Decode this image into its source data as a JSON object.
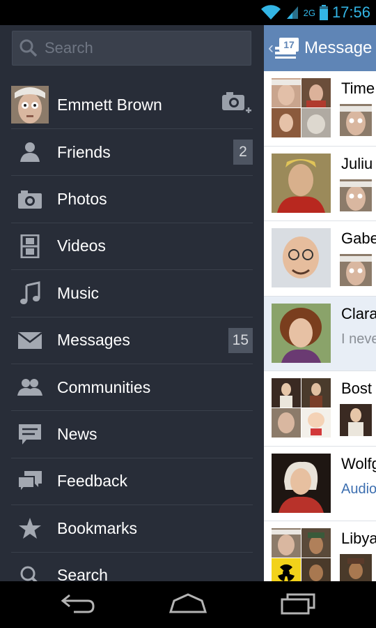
{
  "status_bar": {
    "signal_label": "2G",
    "time": "17:56"
  },
  "drawer": {
    "search_placeholder": "Search",
    "profile": {
      "name": "Emmett Brown"
    },
    "items": [
      {
        "label": "Friends",
        "icon": "person-icon",
        "badge": "2"
      },
      {
        "label": "Photos",
        "icon": "camera-icon"
      },
      {
        "label": "Videos",
        "icon": "film-icon"
      },
      {
        "label": "Music",
        "icon": "music-note-icon"
      },
      {
        "label": "Messages",
        "icon": "envelope-icon",
        "badge": "15"
      },
      {
        "label": "Communities",
        "icon": "group-icon"
      },
      {
        "label": "News",
        "icon": "speech-bubble-icon"
      },
      {
        "label": "Feedback",
        "icon": "chat-bubbles-icon"
      },
      {
        "label": "Bookmarks",
        "icon": "star-icon"
      },
      {
        "label": "Search",
        "icon": "search-icon"
      }
    ]
  },
  "panel": {
    "header": {
      "count": "17",
      "title": "Message"
    },
    "conversations": [
      {
        "title": "Time"
      },
      {
        "title": "Juliu"
      },
      {
        "title": "Gabe"
      },
      {
        "title": "Clara",
        "snippet": "I neve"
      },
      {
        "title": "Bost"
      },
      {
        "title": "Wolfg",
        "snippet": "Audio"
      },
      {
        "title": "Libya"
      }
    ]
  },
  "colors": {
    "drawer_bg": "#282d38",
    "header_bg": "#5f85b6",
    "status_accent": "#33b5e5"
  }
}
